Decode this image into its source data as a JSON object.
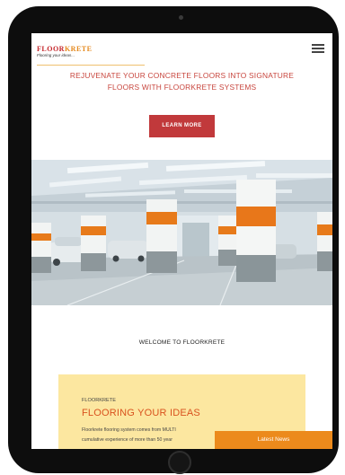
{
  "header": {
    "logo_part1": "FLOOR",
    "logo_part2": "KRETE",
    "tagline": "Flooring your ideas..."
  },
  "hero": {
    "headline_line1": "REJUVENATE YOUR CONCRETE FLOORS INTO SIGNATURE",
    "headline_line2": "FLOORS WITH FLOORKRETE SYSTEMS",
    "cta_label": "LEARN MORE"
  },
  "welcome": {
    "title": "WELCOME TO FLOORKRETE"
  },
  "card": {
    "kicker": "FLOORKRETE",
    "title": "FLOORING YOUR IDEAS",
    "body_line1": "Floorkrete flooring system comes from MULTI",
    "body_line2": "cumulative experience of more than 50 year"
  },
  "news_tab": {
    "label": "Latest News"
  },
  "colors": {
    "accent_red": "#c1393b",
    "accent_orange": "#ec8a1c",
    "card_bg": "#fce7a0"
  }
}
